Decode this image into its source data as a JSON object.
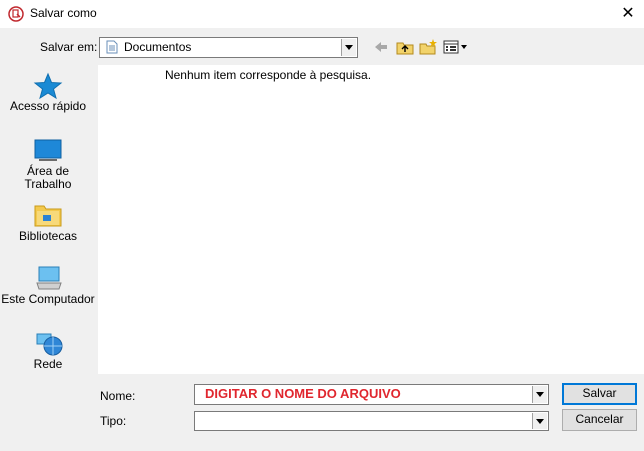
{
  "window": {
    "title": "Salvar como",
    "icon": "app-icon",
    "close_glyph": "✕"
  },
  "save_in": {
    "label": "Salvar em:",
    "value": "Documentos",
    "icon": "documents-icon"
  },
  "toolbar": {
    "buttons": [
      "back-icon",
      "up-folder-icon",
      "new-folder-icon",
      "view-menu-icon"
    ]
  },
  "places": [
    {
      "label": "Acesso rápido",
      "icon": "star-icon"
    },
    {
      "label": "Área de Trabalho",
      "icon": "desktop-icon"
    },
    {
      "label": "Bibliotecas",
      "icon": "libraries-icon"
    },
    {
      "label": "Este Computador",
      "icon": "computer-icon"
    },
    {
      "label": "Rede",
      "icon": "network-icon"
    }
  ],
  "file_list": {
    "empty_message": "Nenhum item corresponde à pesquisa."
  },
  "name": {
    "label": "Nome:",
    "value": "DIGITAR O NOME DO ARQUIVO"
  },
  "type": {
    "label": "Tipo:",
    "value": ""
  },
  "buttons": {
    "save": "Salvar",
    "cancel": "Cancelar"
  },
  "colors": {
    "accent": "#0078d7",
    "name_text": "#e0262e",
    "star": "#1a8ad4"
  }
}
